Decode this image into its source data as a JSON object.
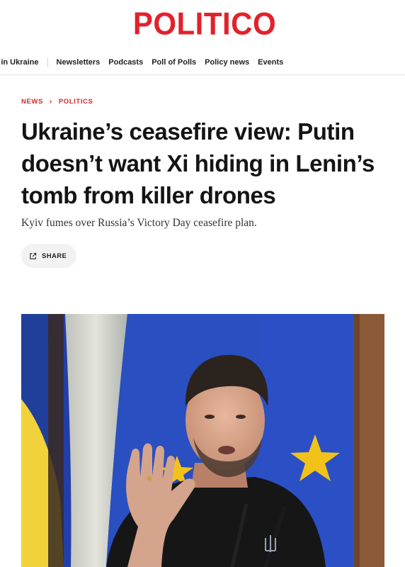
{
  "header": {
    "logo_text": "POLITICO",
    "brand_color": "#e3212b"
  },
  "nav": {
    "items": [
      {
        "label": "r in Ukraine"
      },
      {
        "label": "Newsletters"
      },
      {
        "label": "Podcasts"
      },
      {
        "label": "Poll of Polls"
      },
      {
        "label": "Policy news"
      },
      {
        "label": "Events"
      }
    ]
  },
  "article": {
    "breadcrumb": [
      "NEWS",
      "POLITICS"
    ],
    "breadcrumb_color": "#d12b2b",
    "headline": "Ukraine’s ceasefire view: Putin doesn’t want Xi hiding in Lenin’s tomb from killer drones",
    "dek": "Kyiv fumes over Russia’s Victory Day ceasefire plan.",
    "share_label": "SHARE",
    "share_icon": "share-icon",
    "hero_image": "photo-of-man-raising-hand-at-press-podium"
  }
}
